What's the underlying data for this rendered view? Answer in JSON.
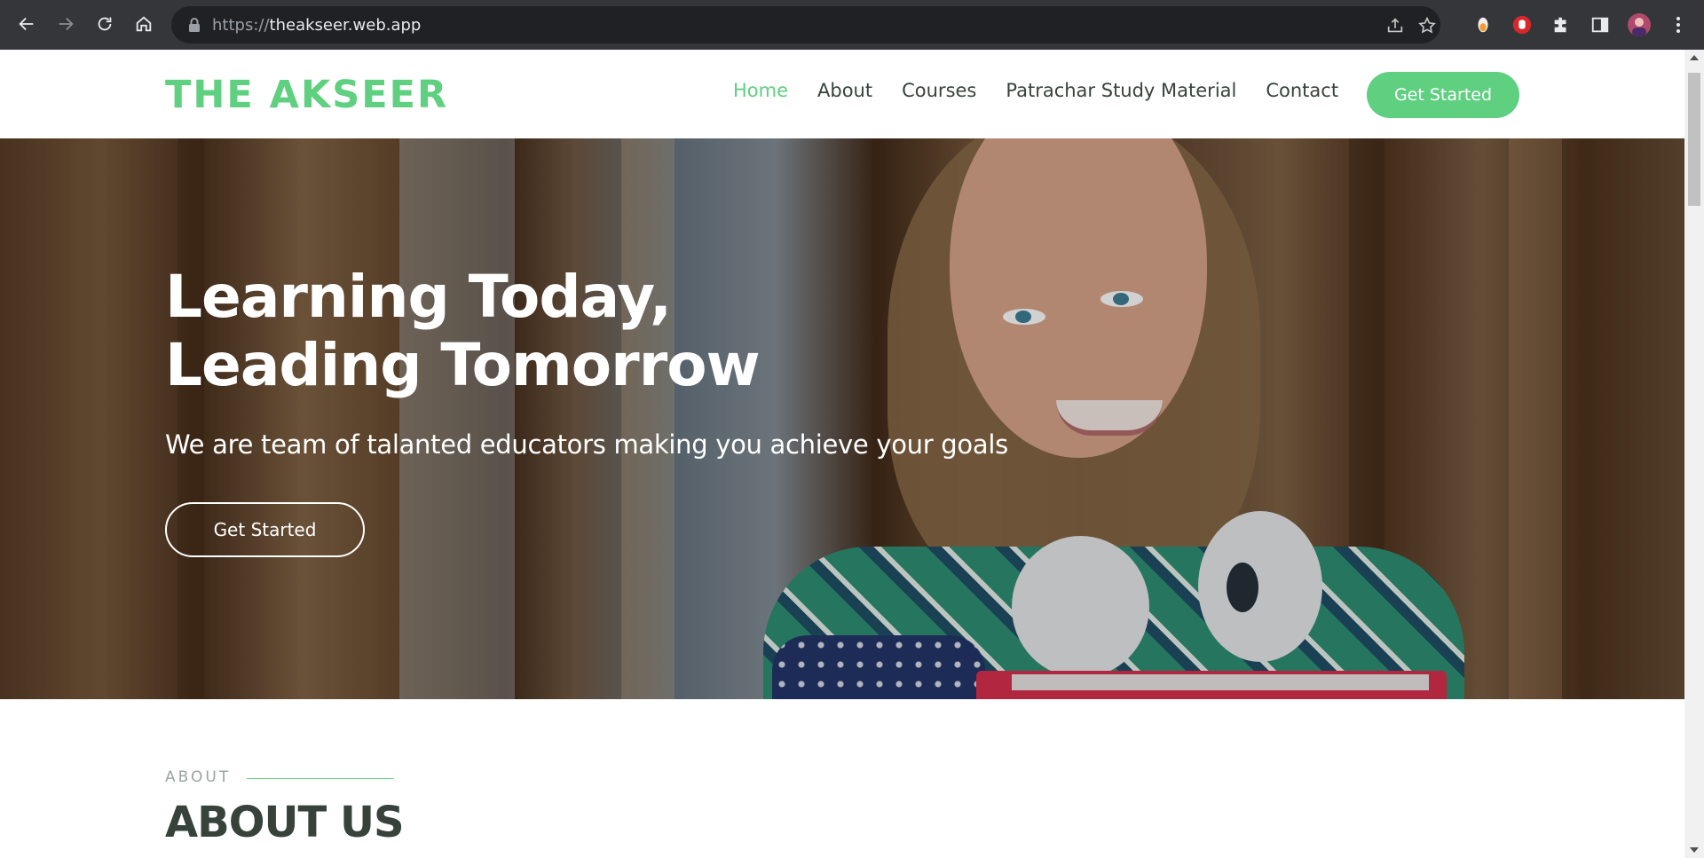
{
  "browser": {
    "url_scheme": "https://",
    "url_host": "theakseer.web.app",
    "icons": {
      "back": "arrow-left-icon",
      "forward": "arrow-right-icon",
      "reload": "reload-icon",
      "home": "home-icon",
      "lock": "lock-icon",
      "share": "share-icon",
      "bookmark": "star-icon",
      "extensions": [
        "extension-orange-icon",
        "extension-red-hand-icon",
        "puzzle-icon"
      ],
      "side_panel": "side-panel-icon",
      "profile": "avatar",
      "menu": "kebab-menu-icon"
    }
  },
  "site": {
    "logo": "THE AKSEER",
    "nav": [
      {
        "label": "Home",
        "active": true
      },
      {
        "label": "About",
        "active": false
      },
      {
        "label": "Courses",
        "active": false
      },
      {
        "label": "Patrachar Study Material",
        "active": false
      },
      {
        "label": "Contact",
        "active": false
      }
    ],
    "cta_label": "Get Started",
    "accent_color": "#5fcf80"
  },
  "hero": {
    "title_line1": "Learning Today,",
    "title_line2": "Leading Tomorrow",
    "subtitle": "We are team of talanted educators making you achieve your goals",
    "button_label": "Get Started"
  },
  "about": {
    "kicker": "ABOUT",
    "title": "ABOUT US"
  }
}
